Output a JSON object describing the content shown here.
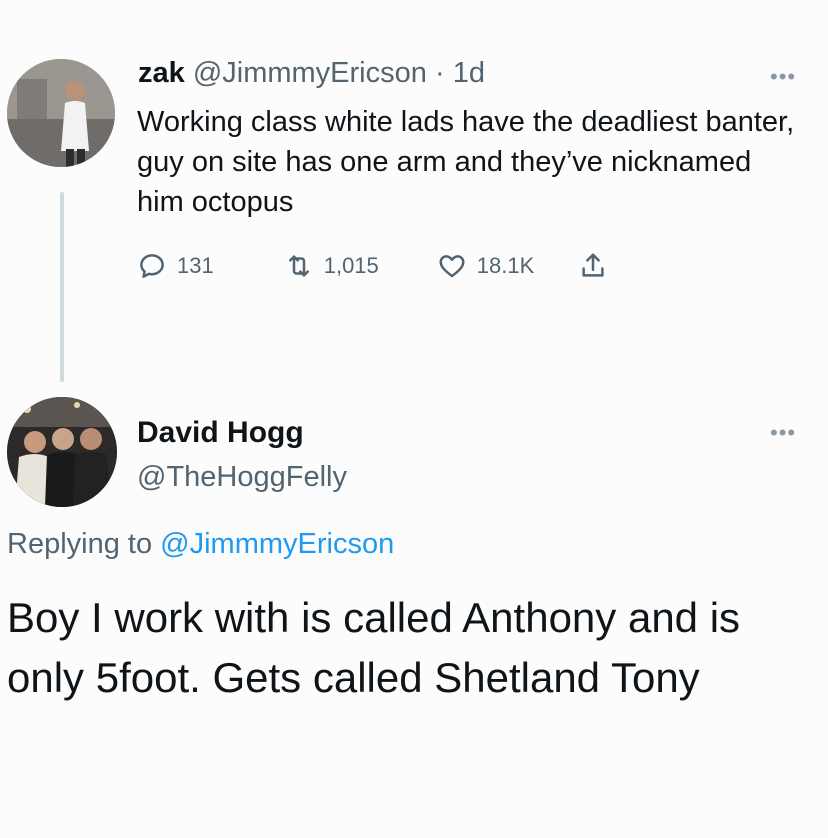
{
  "tweet1": {
    "name": "zak",
    "handle": "@JimmmyEricson",
    "separator": "·",
    "time": "1d",
    "more": "•••",
    "text": "Working class white lads have the deadliest banter, guy on site has one arm and they’ve nicknamed him octopus",
    "stats": {
      "replies": "131",
      "retweets": "1,015",
      "likes": "18.1K"
    },
    "icons": [
      "reply-icon",
      "retweet-icon",
      "like-icon",
      "share-icon"
    ],
    "avatar": "profile-photo-zak"
  },
  "tweet2": {
    "name": "David Hogg",
    "handle": "@TheHoggFelly",
    "more": "•••",
    "replying_prefix": "Replying to",
    "replying_handle": "@JimmmyEricson",
    "text": "Boy I work with is called Anthony and is only 5foot. Gets called Shetland Tony",
    "avatar": "profile-photo-david-hogg"
  },
  "colors": {
    "text": "#0f1419",
    "muted": "#536471",
    "link": "#1d9bf0",
    "thread_line": "#cfd9de",
    "background": "#fcfcfc"
  }
}
